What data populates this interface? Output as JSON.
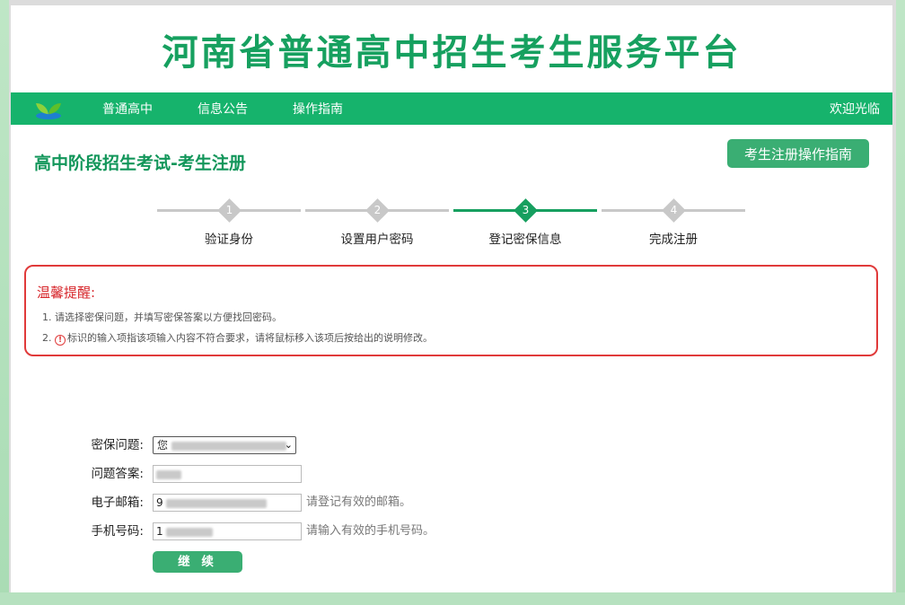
{
  "site_title": "河南省普通高中招生考生服务平台",
  "nav": {
    "items": [
      "普通高中",
      "信息公告",
      "操作指南"
    ],
    "welcome": "欢迎光临"
  },
  "page_title": "高中阶段招生考试-考生注册",
  "guide_button": "考生注册操作指南",
  "steps": [
    {
      "num": "1",
      "label": "验证身份",
      "active": false
    },
    {
      "num": "2",
      "label": "设置用户密码",
      "active": false
    },
    {
      "num": "3",
      "label": "登记密保信息",
      "active": true
    },
    {
      "num": "4",
      "label": "完成注册",
      "active": false
    }
  ],
  "notice": {
    "title": "温馨提醒:",
    "line1": "1. 请选择密保问题，并填写密保答案以方便找回密码。",
    "line2_prefix": "2. ",
    "line2": "标识的输入项指该项输入内容不符合要求，请将鼠标移入该项后按给出的说明修改。"
  },
  "form": {
    "question_label": "密保问题:",
    "question_value": "您",
    "answer_label": "问题答案:",
    "answer_value": "",
    "email_label": "电子邮箱:",
    "email_value": "9",
    "email_hint": "请登记有效的邮箱。",
    "phone_label": "手机号码:",
    "phone_value": "1",
    "phone_hint": "请输入有效的手机号码。",
    "continue_label": "继 续"
  },
  "colors": {
    "brand_green": "#16b36c",
    "title_green": "#16a05f",
    "button_green": "#3aae73",
    "notice_red": "#e03a3a",
    "inactive_step": "#c8c8c8"
  }
}
